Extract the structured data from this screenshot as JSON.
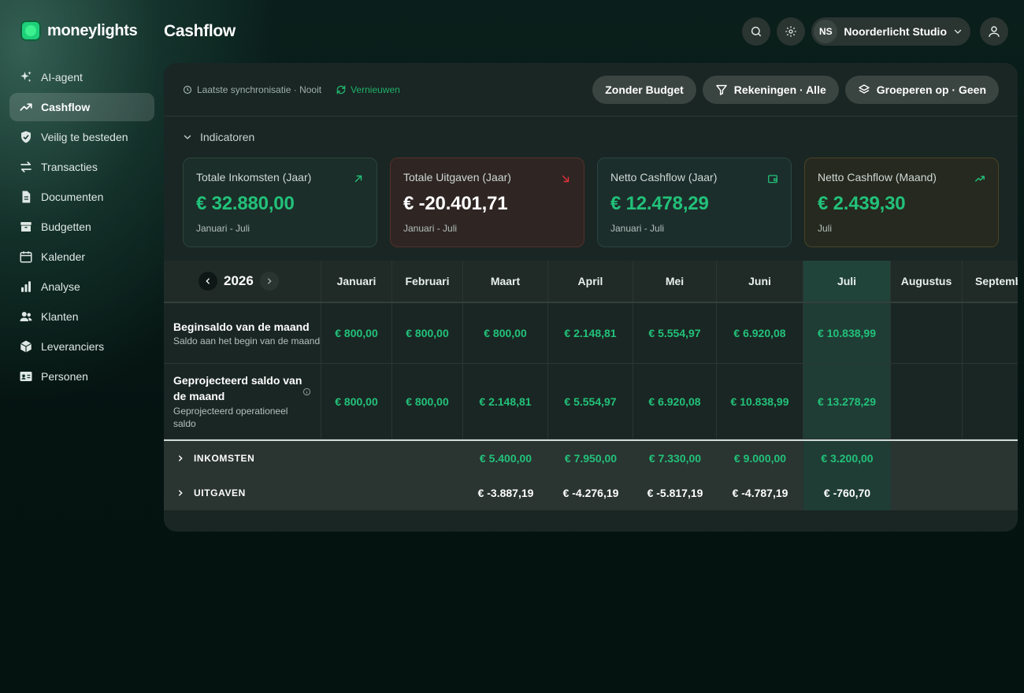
{
  "app": {
    "logo_text": "moneylights",
    "page_title": "Cashflow"
  },
  "colors": {
    "accent": "#22c17a",
    "negative": "#e0303a",
    "bg": "#041210"
  },
  "sidebar": {
    "items": [
      {
        "label": "AI-agent",
        "icon": "sparkles-icon",
        "active": false
      },
      {
        "label": "Cashflow",
        "icon": "trend-up-icon",
        "active": true
      },
      {
        "label": "Veilig te besteden",
        "icon": "shield-icon",
        "active": false
      },
      {
        "label": "Transacties",
        "icon": "arrows-exchange-icon",
        "active": false
      },
      {
        "label": "Documenten",
        "icon": "document-icon",
        "active": false
      },
      {
        "label": "Budgetten",
        "icon": "archive-box-icon",
        "active": false
      },
      {
        "label": "Kalender",
        "icon": "calendar-icon",
        "active": false
      },
      {
        "label": "Analyse",
        "icon": "bar-chart-icon",
        "active": false
      },
      {
        "label": "Klanten",
        "icon": "users-icon",
        "active": false
      },
      {
        "label": "Leveranciers",
        "icon": "cube-icon",
        "active": false
      },
      {
        "label": "Personen",
        "icon": "id-card-icon",
        "active": false
      }
    ]
  },
  "header": {
    "org_initials": "NS",
    "org_name": "Noorderlicht Studio"
  },
  "toolbar": {
    "sync_text": "Laatste synchronisatie · Nooit",
    "refresh_label": "Vernieuwen",
    "budget_label": "Zonder Budget",
    "accounts_label": "Rekeningen · Alle",
    "group_label": "Groeperen op · Geen"
  },
  "indicators": {
    "heading": "Indicatoren",
    "cards": [
      {
        "label": "Totale Inkomsten (Jaar)",
        "value": "€ 32.880,00",
        "sub": "Januari - Juli"
      },
      {
        "label": "Totale Uitgaven (Jaar)",
        "value": "€ -20.401,71",
        "sub": "Januari - Juli"
      },
      {
        "label": "Netto Cashflow (Jaar)",
        "value": "€ 12.478,29",
        "sub": "Januari - Juli"
      },
      {
        "label": "Netto Cashflow (Maand)",
        "value": "€ 2.439,30",
        "sub": "Juli"
      }
    ]
  },
  "table": {
    "year": "2026",
    "months": [
      "Januari",
      "Februari",
      "Maart",
      "April",
      "Mei",
      "Juni",
      "Juli",
      "Augustus",
      "September"
    ],
    "rows": [
      {
        "title": "Beginsaldo van de maand",
        "subtitle": "Saldo aan het begin van de maand",
        "values": [
          "€ 800,00",
          "€ 800,00",
          "€ 800,00",
          "€ 2.148,81",
          "€ 5.554,97",
          "€ 6.920,08",
          "€ 10.838,99",
          "",
          ""
        ]
      },
      {
        "title": "Geprojecteerd saldo van de maand",
        "subtitle": "Geprojecteerd operationeel saldo",
        "values": [
          "€ 800,00",
          "€ 800,00",
          "€ 2.148,81",
          "€ 5.554,97",
          "€ 6.920,08",
          "€ 10.838,99",
          "€ 13.278,29",
          "",
          ""
        ]
      }
    ],
    "summary": [
      {
        "label": "INKOMSTEN",
        "values": [
          "",
          "",
          "€ 5.400,00",
          "€ 7.950,00",
          "€ 7.330,00",
          "€ 9.000,00",
          "€ 3.200,00",
          "",
          ""
        ]
      },
      {
        "label": "UITGAVEN",
        "values": [
          "",
          "",
          "€ -3.887,19",
          "€ -4.276,19",
          "€ -5.817,19",
          "€ -4.787,19",
          "€ -760,70",
          "",
          ""
        ]
      }
    ]
  }
}
